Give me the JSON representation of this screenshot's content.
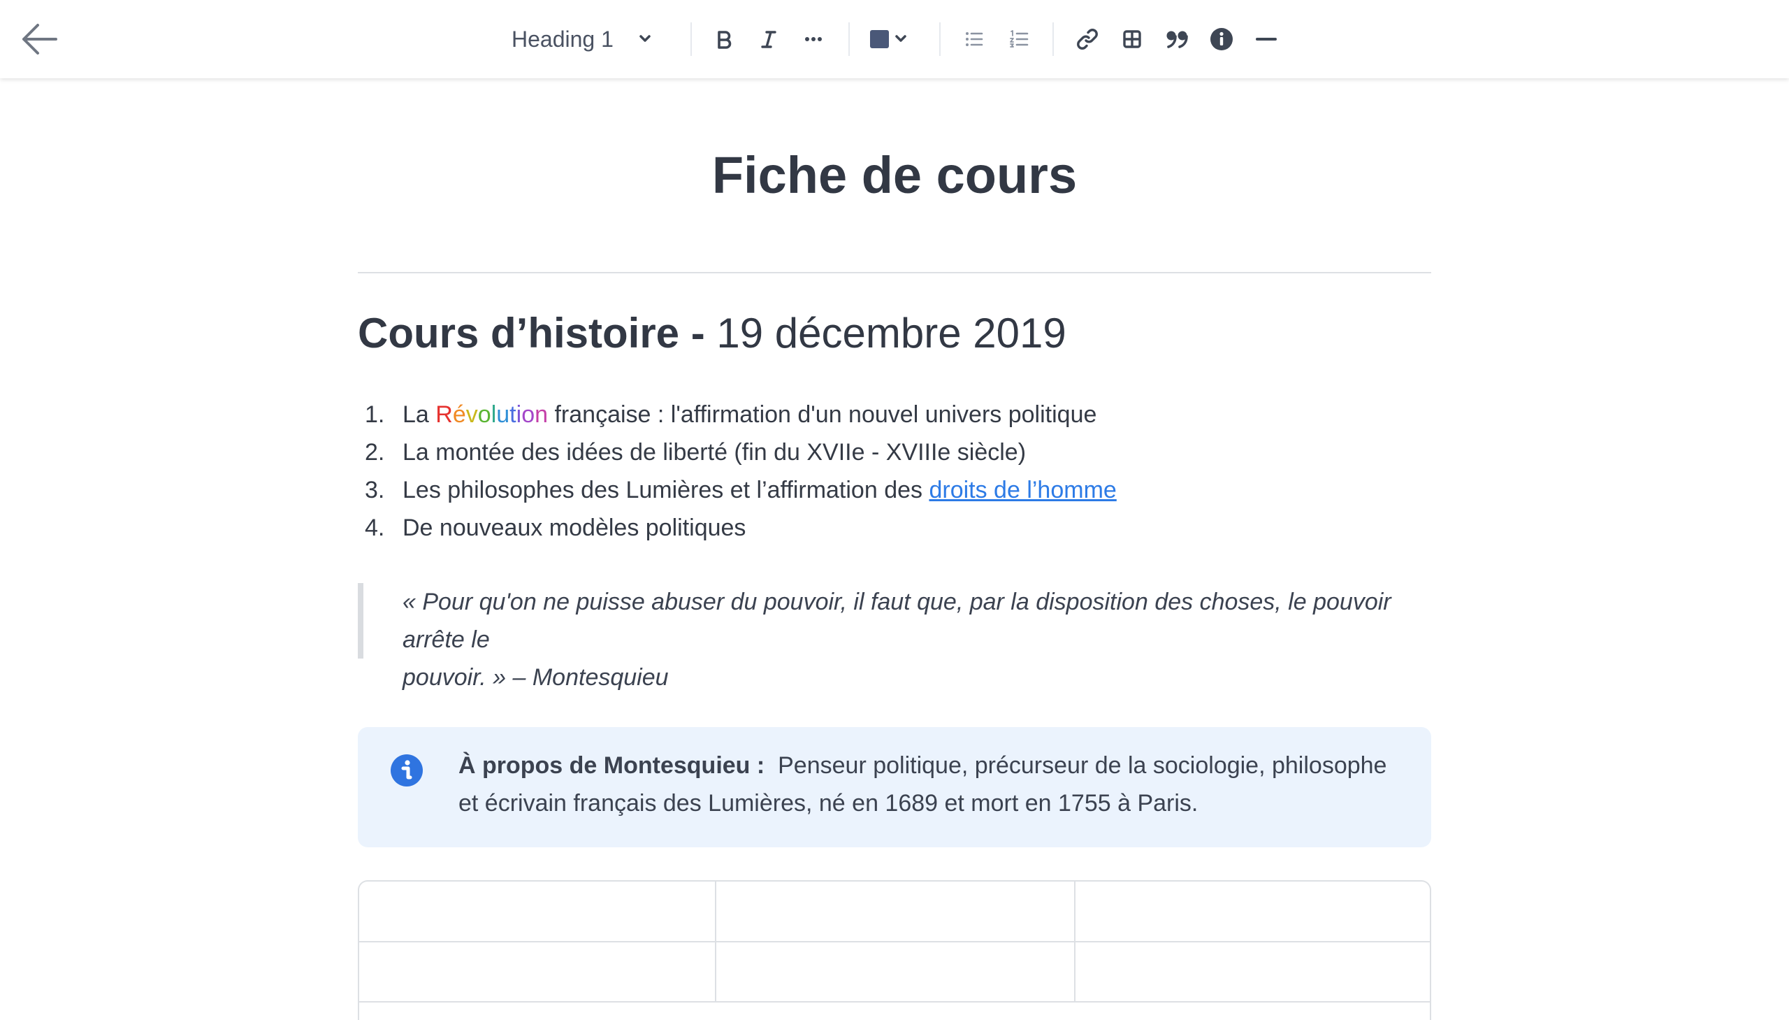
{
  "toolbar": {
    "back_icon": "arrow-left-icon",
    "heading_select": "Heading 1",
    "buttons": [
      "bold-icon",
      "italic-icon",
      "more-icon",
      "color-icon",
      "bullet-list-icon",
      "numbered-list-icon",
      "link-icon",
      "table-icon",
      "quote-icon",
      "info-icon",
      "divider-icon"
    ],
    "color_swatch": "#4a5878"
  },
  "document": {
    "title": "Fiche de cours",
    "heading": {
      "bold": "Cours d’histoire -",
      "normal": "19 décembre 2019"
    },
    "list": [
      {
        "num": "1.",
        "prefix": "La",
        "rainbow": [
          "R",
          "é",
          "v",
          "o",
          "l",
          "u",
          "t",
          "i",
          "o",
          "n"
        ],
        "suffix": "française : l'affirmation d'un nouvel univers politique"
      },
      {
        "num": "2.",
        "text": "La montée des idées de liberté (fin du XVIIe - XVIIIe siècle)"
      },
      {
        "num": "3.",
        "text": "Les philosophes des Lumières et l’affirmation des",
        "link": "droits de l’homme"
      },
      {
        "num": "4.",
        "text": "De nouveaux modèles politiques"
      }
    ],
    "rainbow_colors": [
      "#e6322f",
      "#f08a24",
      "#c9b81c",
      "#5bb533",
      "#2fa98c",
      "#2f8fd6",
      "#4a6fe0",
      "#7b54d8",
      "#a347c9",
      "#c43fa8"
    ],
    "quote_line1": "« Pour qu'on ne puisse abuser du pouvoir, il faut que, par la disposition des choses, le pouvoir arrête le",
    "quote_line2": "pouvoir. » – Montesquieu",
    "callout": {
      "icon": "info-circle-icon",
      "label": "À propos de Montesquieu :",
      "text_line1": "Penseur politique, précurseur de la sociologie, philosophe",
      "text_line2": "et écrivain français des Lumières, né en 1689 et mort en 1755 à Paris."
    }
  },
  "colors": {
    "link": "#2d7be6",
    "callout_bg": "#ebf3fd",
    "info_icon": "#2f74e0"
  }
}
